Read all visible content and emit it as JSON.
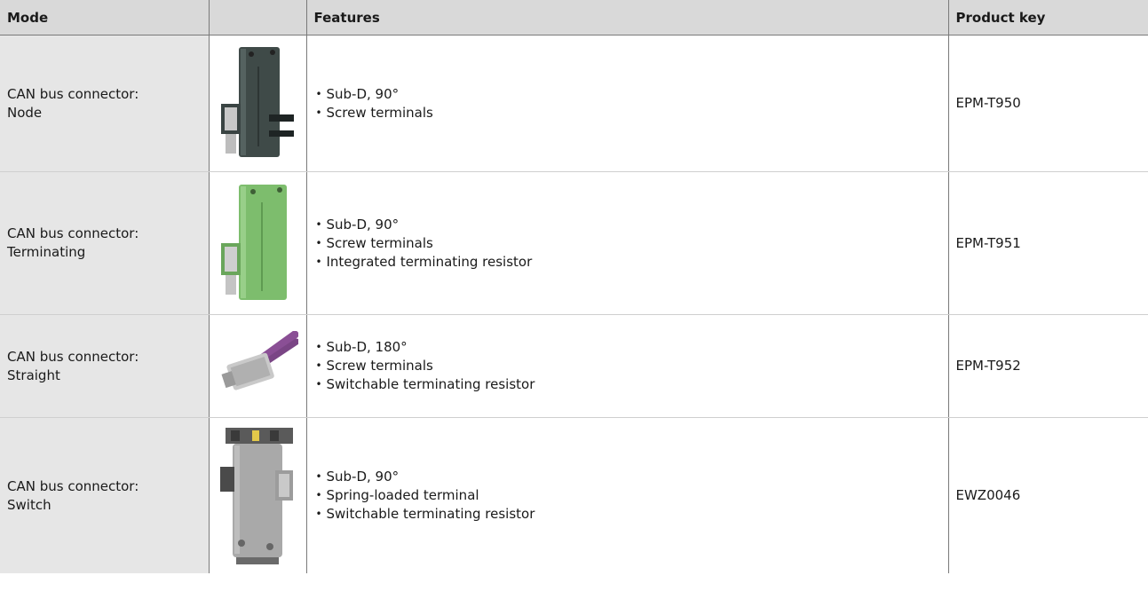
{
  "table": {
    "headers": {
      "mode": "Mode",
      "image": "",
      "features": "Features",
      "product_key": "Product key"
    },
    "rows": [
      {
        "mode_line1": "CAN bus connector:",
        "mode_line2": "Node",
        "image_icon": "dark-gray-90-degree-connector-photo",
        "features": [
          "Sub-D, 90°",
          "Screw terminals"
        ],
        "product_key": "EPM-T950"
      },
      {
        "mode_line1": "CAN bus connector:",
        "mode_line2": "Terminating",
        "image_icon": "green-90-degree-connector-photo",
        "features": [
          "Sub-D, 90°",
          "Screw terminals",
          "Integrated terminating resistor"
        ],
        "product_key": "EPM-T951"
      },
      {
        "mode_line1": "CAN bus connector:",
        "mode_line2": "Straight",
        "image_icon": "straight-connector-with-purple-cable-photo",
        "features": [
          "Sub-D, 180°",
          "Screw terminals",
          "Switchable terminating resistor"
        ],
        "product_key": "EPM-T952"
      },
      {
        "mode_line1": "CAN bus connector:",
        "mode_line2": "Switch",
        "image_icon": "gray-90-degree-switch-connector-photo",
        "features": [
          "Sub-D, 90°",
          "Spring-loaded terminal",
          "Switchable terminating resistor"
        ],
        "product_key": "EWZ0046"
      }
    ]
  }
}
